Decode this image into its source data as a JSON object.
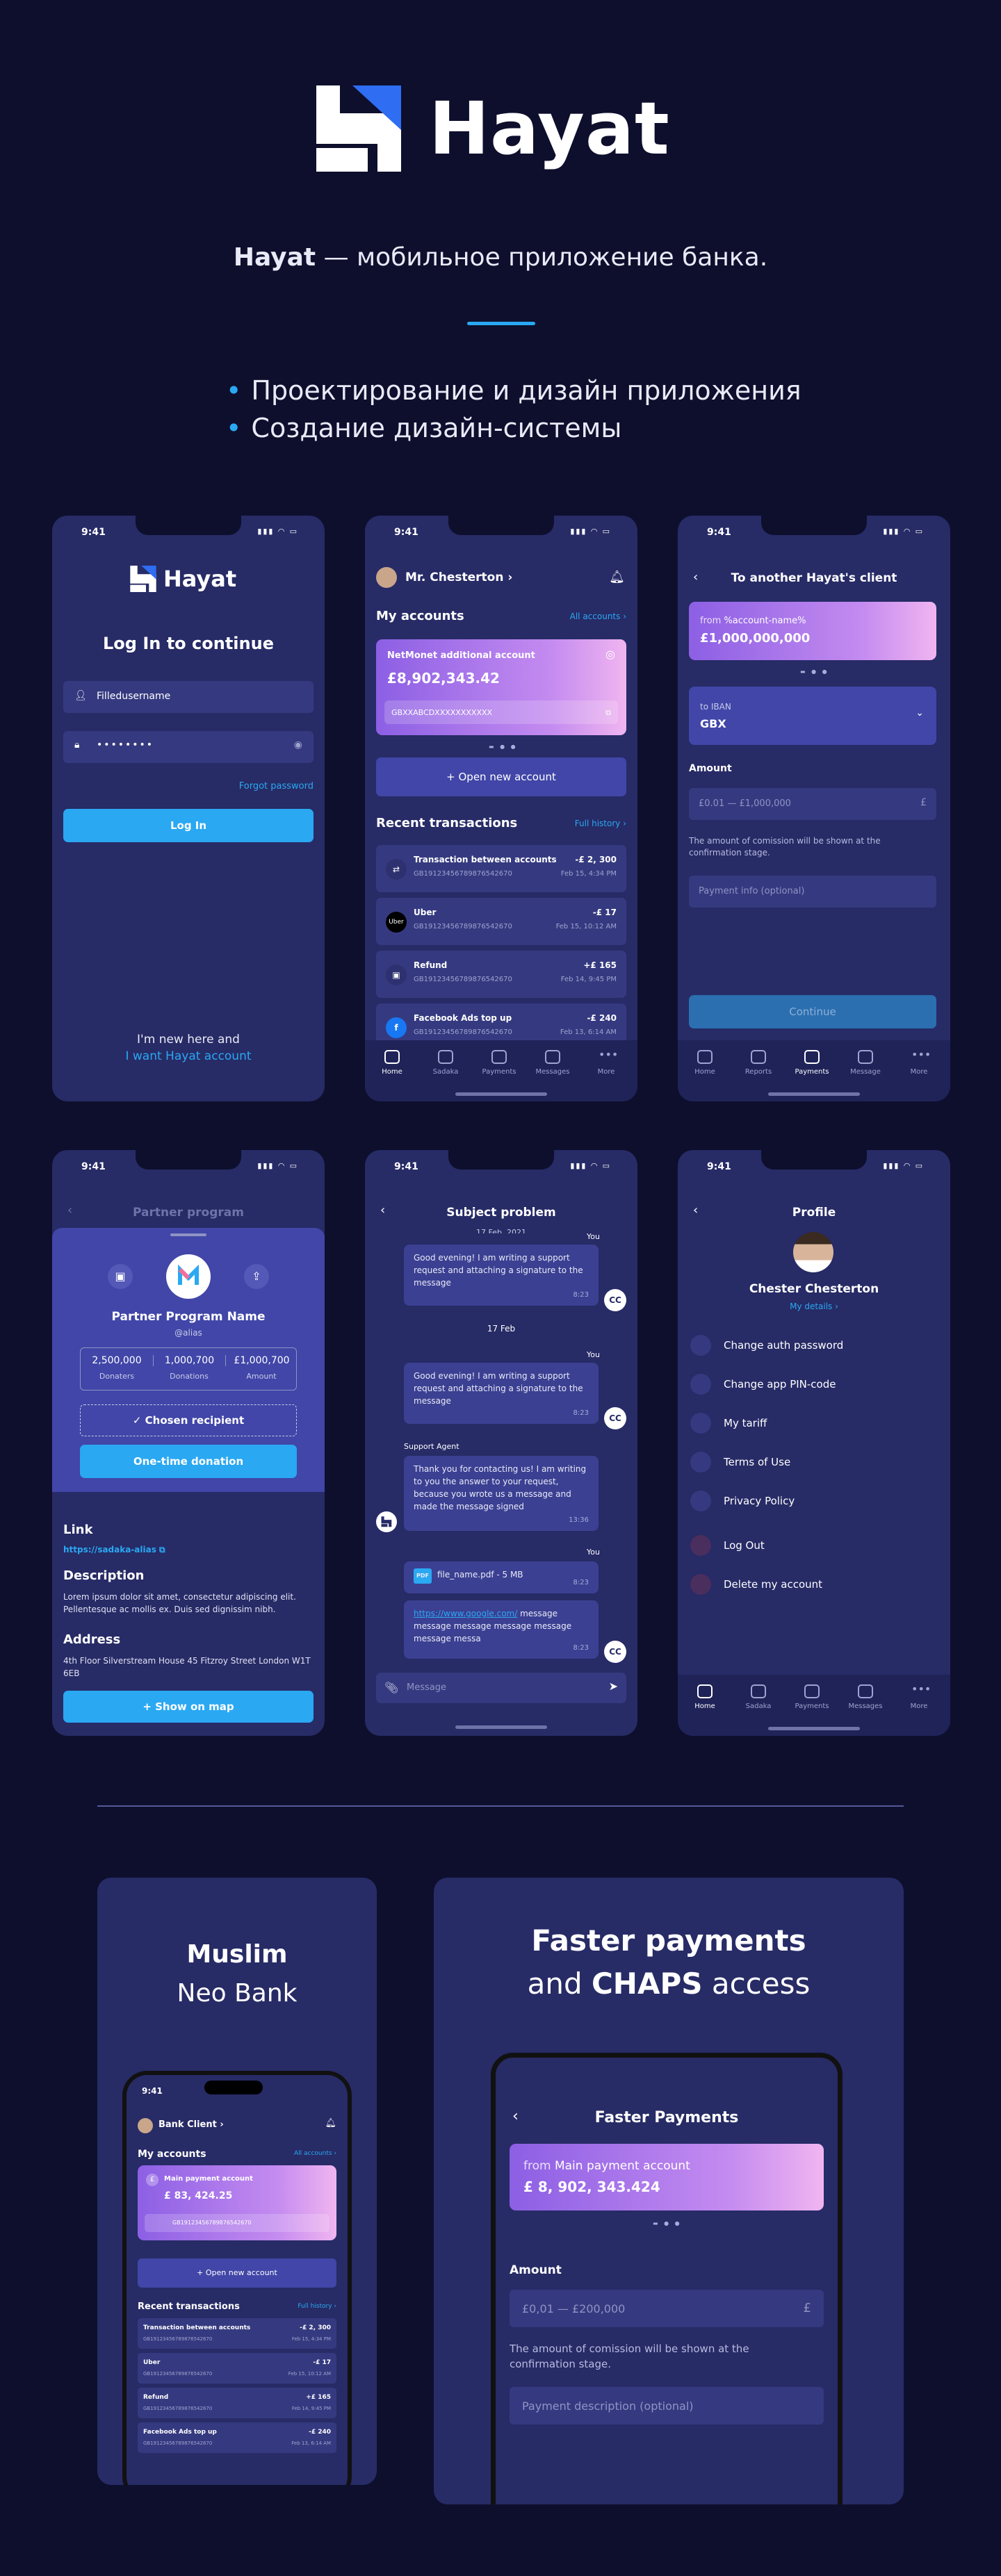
{
  "brand": {
    "name": "Hayat",
    "tagline_bold": "Hayat",
    "tagline_rest": " — мобильное приложение банка.",
    "accent": "#2aa8f2",
    "bg": "#0e0f2d",
    "panel": "#272b66"
  },
  "bullets": [
    "Проектирование и дизайн приложения",
    "Создание дизайн-системы"
  ],
  "status_time": "9:41",
  "login": {
    "logo": "Hayat",
    "title": "Log In to continue",
    "username": "Filledusername",
    "password": "••••••••",
    "forgot": "Forgot password",
    "login_btn": "Log In",
    "new_here": "I'm new here and",
    "want": "I want Hayat account"
  },
  "home": {
    "user": "Mr. Chesterton",
    "my_accounts": "My accounts",
    "all_accounts": "All accounts",
    "card_title": "NetMonet additional account",
    "card_amount": "£8,902,343.42",
    "card_number": "GBXXABCDXXXXXXXXXXX",
    "open_account": "Open new account",
    "recent": "Recent transactions",
    "full_history": "Full history",
    "transactions": [
      {
        "name": "Transaction between accounts",
        "acc": "GB19123456789876542670",
        "amount": "-£ 2, 300",
        "date": "Feb 15, 4:34 PM",
        "icon": "⇄"
      },
      {
        "name": "Uber",
        "acc": "GB19123456789876542670",
        "amount": "-£ 17",
        "date": "Feb 15, 10:12 AM",
        "icon": "Uber"
      },
      {
        "name": "Refund",
        "acc": "GB19123456789876542670",
        "amount": "+£ 165",
        "date": "Feb 14, 9:45 PM",
        "icon": "▣"
      },
      {
        "name": "Facebook Ads top up",
        "acc": "GB19123456789876542670",
        "amount": "-£ 240",
        "date": "Feb 13, 6:14 AM",
        "icon": "f"
      }
    ]
  },
  "tabs1": [
    "Home",
    "Sadaka",
    "Payments",
    "Messages",
    "More"
  ],
  "tabs2": [
    "Home",
    "Reports",
    "Payments",
    "Message",
    "More"
  ],
  "transfer": {
    "title": "To another Hayat's client",
    "from_label": "from",
    "from_name": "%account-name%",
    "from_amount": "£1,000,000,000",
    "to_label": "to IBAN",
    "to_value": "GBX",
    "amount_label": "Amount",
    "amount_ph": "£0.01 — £1,000,000",
    "currency": "£",
    "note": "The amount of comission will be shown at the confirmation stage.",
    "payment_info": "Payment info (optional)",
    "continue": "Continue"
  },
  "partner": {
    "header": "Partner program",
    "name": "Partner Program Name",
    "alias": "@alias",
    "stats": [
      {
        "v": "2,500,000",
        "l": "Donaters"
      },
      {
        "v": "1,000,700",
        "l": "Donations"
      },
      {
        "v": "£1,000,700",
        "l": "Amount"
      }
    ],
    "chosen": "Chosen recipient",
    "donate": "One-time donation",
    "link_h": "Link",
    "link": "https://sadaka-alias",
    "desc_h": "Description",
    "desc": "Lorem ipsum dolor sit amet, consectetur adipiscing elit. Pellentesque ac mollis ex. Duis sed dignissim nibh.",
    "addr_h": "Address",
    "addr": "4th Floor Silverstream House 45 Fitzroy Street London W1T 6EB",
    "map": "Show on map"
  },
  "chat": {
    "title": "Subject problem",
    "date_top": "17 Feb, 2021",
    "you": "You",
    "msg1": "Good evening! I am writing a support request and attaching a signature to the message",
    "t1": "8:23",
    "date2": "17 Feb",
    "agent": "Support Agent",
    "msg3": "Thank you for contacting us! I am writing to you the answer to your request, because you wrote us a message and made the message signed",
    "t3": "13:36",
    "file": "file_name.pdf - 5 MB",
    "pdf": "PDF",
    "link": "https://www.google.com/",
    "msg5": " message message message message message message messa",
    "cc": "CC",
    "input_ph": "Message"
  },
  "profile": {
    "title": "Profile",
    "name": "Chester Chesterton",
    "details": "My details",
    "items": [
      "Change auth password",
      "Change app PIN-code",
      "My tariff",
      "Terms of Use",
      "Privacy Policy"
    ],
    "logout": "Log Out",
    "delete": "Delete my account"
  },
  "promo1": {
    "l1": "Muslim",
    "l2": "Neo Bank",
    "user": "Bank Client",
    "my_accounts": "My accounts",
    "all": "All accounts",
    "card_title": "Main payment account",
    "card_amount": "£ 83, 424.25",
    "card_number": "GB19123456789876542670",
    "open": "Open new account",
    "recent": "Recent transactions",
    "full": "Full history",
    "rows": [
      {
        "n": "Transaction between accounts",
        "a": "-£ 2, 300",
        "d": "Feb 15, 4:34 PM"
      },
      {
        "n": "Uber",
        "a": "-£ 17",
        "d": "Feb 15, 10:12 AM"
      },
      {
        "n": "Refund",
        "a": "+£ 165",
        "d": "Feb 14, 9:45 PM"
      },
      {
        "n": "Facebook Ads top up",
        "a": "-£ 240",
        "d": "Feb 13, 6:14 AM"
      }
    ],
    "acc": "GB19123456789876542670"
  },
  "promo2": {
    "l1": "Faster payments",
    "l2a": "and ",
    "l2b": "CHAPS",
    "l2c": " access",
    "screen_title": "Faster Payments",
    "from": "from",
    "from_name": "Main payment account",
    "amount": "£ 8, 902, 343.424",
    "amount_label": "Amount",
    "amount_ph": "£0,01 — £200,000",
    "currency": "£",
    "note": "The amount of comission will be shown at the confirmation stage.",
    "desc_ph": "Payment description (optional)"
  }
}
